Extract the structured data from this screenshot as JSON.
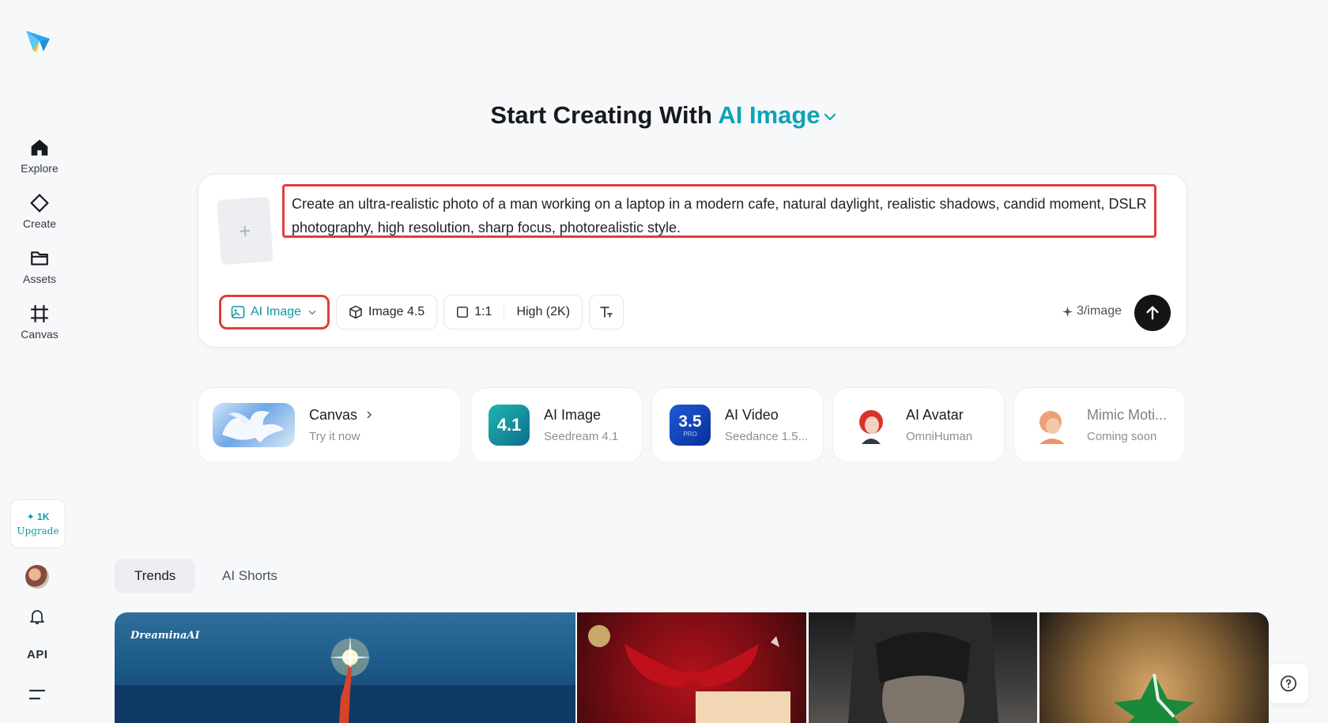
{
  "sidebar": {
    "nav": [
      {
        "label": "Explore",
        "icon": "home-icon"
      },
      {
        "label": "Create",
        "icon": "diamond-icon"
      },
      {
        "label": "Assets",
        "icon": "folder-icon"
      },
      {
        "label": "Canvas",
        "icon": "canvas-icon"
      }
    ],
    "credits": "✦ 1K",
    "upgrade": "Upgrade",
    "api": "API"
  },
  "heading": {
    "prefix": "Start Creating With",
    "mode": "AI Image"
  },
  "prompt": {
    "text": "Create an ultra-realistic photo of a man working on a laptop in a modern cafe, natural daylight, realistic shadows, candid moment, DSLR photography, high resolution, sharp focus, photorealistic style.",
    "upload_symbol": "+"
  },
  "toolbar": {
    "mode": "AI Image",
    "model": "Image 4.5",
    "ratio": "1:1",
    "quality": "High (2K)",
    "cost": "3/image"
  },
  "features": [
    {
      "title": "Canvas",
      "subtitle": "Try it now"
    },
    {
      "title": "AI Image",
      "subtitle": "Seedream 4.1",
      "badge": "4.1"
    },
    {
      "title": "AI Video",
      "subtitle": "Seedance 1.5...",
      "badge": "3.5",
      "badge_sub": "PRO"
    },
    {
      "title": "AI Avatar",
      "subtitle": "OmniHuman"
    },
    {
      "title": "Mimic Moti...",
      "subtitle": "Coming soon"
    }
  ],
  "tabs": [
    {
      "label": "Trends"
    },
    {
      "label": "AI Shorts"
    }
  ],
  "gallery": {
    "watermark": "DreaminaAI"
  },
  "colors": {
    "accent": "#0fa3b5",
    "highlight": "#e23c3c"
  }
}
